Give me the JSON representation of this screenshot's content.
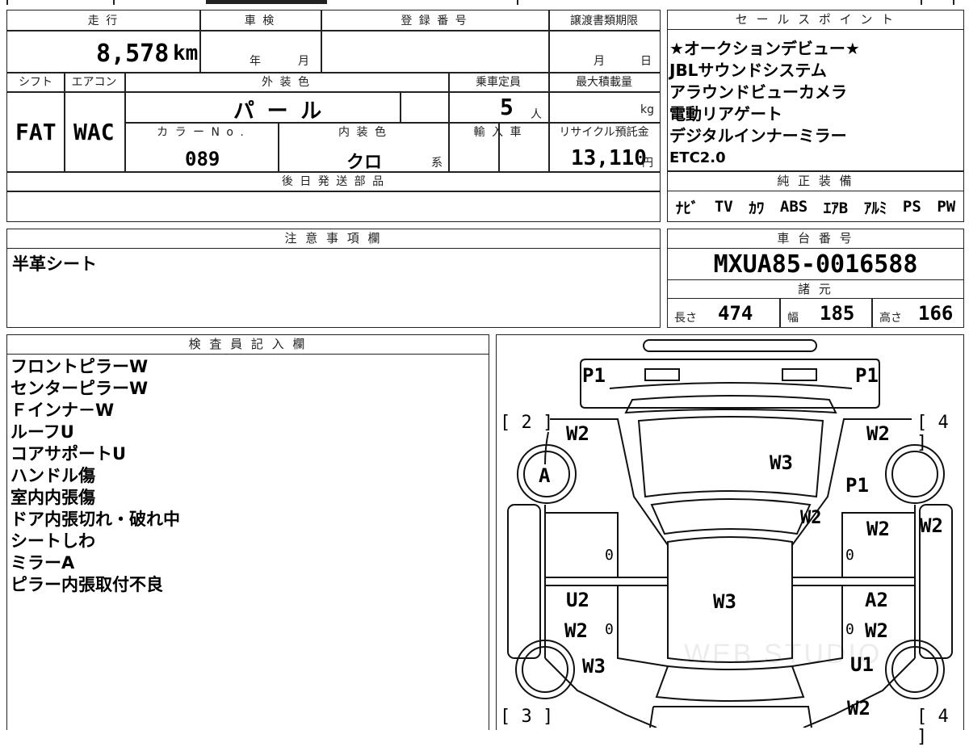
{
  "top": {
    "mileage_label": "走 行",
    "mileage_value": "8,578",
    "mileage_unit": "km",
    "inspection_label": "車 検",
    "year_unit": "年",
    "month_unit": "月",
    "reg_number_label": "登 録 番 号",
    "transfer_label": "譲渡書類期限",
    "transfer_month": "月",
    "transfer_day": "日",
    "shift_label": "シフト",
    "shift_value": "FAT",
    "aircon_label": "エアコン",
    "aircon_value": "WAC",
    "exterior_label": "外 装 色",
    "exterior_value": "パ ー ル",
    "capacity_label": "乗車定員",
    "capacity_value": "5",
    "capacity_unit": "人",
    "load_label": "最大積載量",
    "load_unit": "kg",
    "color_no_label": "カ ラ ー N o .",
    "color_no_value": "089",
    "interior_label": "内 装 色",
    "interior_value": "クロ",
    "interior_suffix": "系",
    "import_label": "輸 入 車",
    "recycle_label": "リサイクル預託金",
    "recycle_value": "13,110",
    "recycle_unit": "円",
    "later_parts_label": "後 日 発 送 部 品"
  },
  "sales": {
    "label": "セ ー ル ス ポ イ ン ト",
    "lines": [
      "★オークションデビュー★",
      "JBLサウンドシステム",
      "アラウンドビューカメラ",
      "電動リアゲート",
      "デジタルインナーミラー",
      "ETC2.0"
    ]
  },
  "equipment": {
    "label": "純 正 装 備",
    "items": [
      "ﾅﾋﾞ",
      "TV",
      "ｶﾜ",
      "ABS",
      "ｴｱB",
      "ｱﾙﾐ",
      "PS",
      "PW"
    ]
  },
  "notes": {
    "label": "注 意 事 項 欄",
    "text": "半革シート"
  },
  "chassis": {
    "label": "車 台 番 号",
    "value": "MXUA85-0016588"
  },
  "specs": {
    "label": "諸 元",
    "length_label": "長さ",
    "length_value": "474",
    "width_label": "幅",
    "width_value": "185",
    "height_label": "高さ",
    "height_value": "166"
  },
  "inspector": {
    "label": "検 査 員 記 入 欄",
    "lines": [
      "フロントピラーW",
      "センターピラーW",
      "Ｆインナ－W",
      "ルーフU",
      "コアサポートU",
      "ハンドル傷",
      "室内内張傷",
      "ドア内張切れ・破れ中",
      "シートしわ",
      "ミラーA",
      "ピラー内張取付不良"
    ]
  },
  "diagram": {
    "corner_tl": "[ 2 ]",
    "corner_tr": "[ 4 ]",
    "corner_bl": "[ 3 ]",
    "corner_br": "[ 4 ]",
    "marks": [
      "P1",
      "P1",
      "W2",
      "W2",
      "W3",
      "A",
      "P1",
      "W2",
      "W2",
      "W2",
      "0",
      "0",
      "U2",
      "W3",
      "A2",
      "W2",
      "0",
      "0",
      "W2",
      "W3",
      "U1",
      "W2"
    ],
    "watermark": "WEB STUDIO"
  }
}
